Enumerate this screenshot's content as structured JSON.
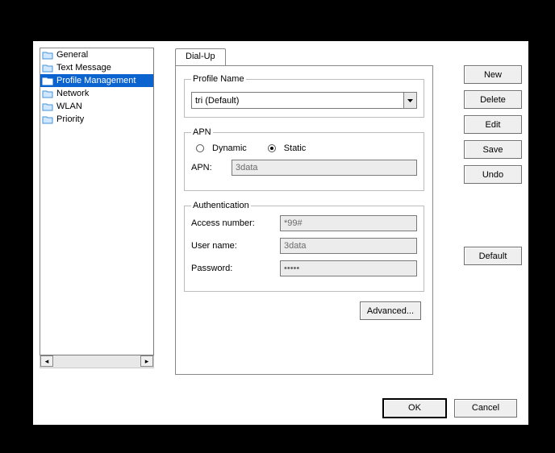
{
  "sidebar": {
    "items": [
      {
        "label": "General"
      },
      {
        "label": "Text Message"
      },
      {
        "label": "Profile Management",
        "selected": true
      },
      {
        "label": "Network"
      },
      {
        "label": "WLAN"
      },
      {
        "label": "Priority"
      }
    ]
  },
  "tabs": {
    "active": "Dial-Up"
  },
  "profile": {
    "legend": "Profile Name",
    "value": "tri (Default)"
  },
  "apn": {
    "legend": "APN",
    "dynamic_label": "Dynamic",
    "static_label": "Static",
    "mode": "static",
    "apn_label": "APN:",
    "apn_value": "3data"
  },
  "auth": {
    "legend": "Authentication",
    "access_label": "Access number:",
    "access_value": "*99#",
    "user_label": "User name:",
    "user_value": "3data",
    "pass_label": "Password:",
    "pass_value": "•••••"
  },
  "buttons": {
    "new": "New",
    "delete": "Delete",
    "edit": "Edit",
    "save": "Save",
    "undo": "Undo",
    "default": "Default",
    "advanced": "Advanced...",
    "ok": "OK",
    "cancel": "Cancel"
  }
}
